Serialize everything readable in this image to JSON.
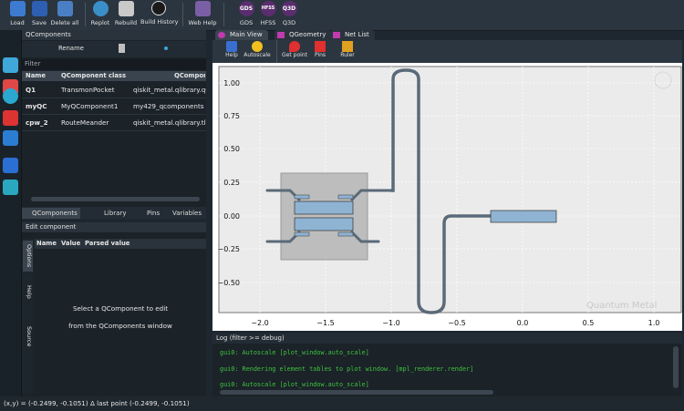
{
  "toolbar": {
    "buttons": [
      {
        "label": "Load",
        "icon": "folder-icon"
      },
      {
        "label": "Save",
        "icon": "floppy-disk-icon"
      },
      {
        "label": "Delete all",
        "icon": "trash-icon"
      },
      {
        "label": "Replot",
        "icon": "replot-icon"
      },
      {
        "label": "Rebuild",
        "icon": "tools-icon"
      },
      {
        "label": "Build History",
        "icon": "history-clock-icon"
      },
      {
        "label": "Web Help",
        "icon": "web-help-icon"
      },
      {
        "label": "GDS",
        "icon": "gds-icon",
        "badge": "GDS"
      },
      {
        "label": "HFSS",
        "icon": "hfss-icon",
        "badge": "HFSS"
      },
      {
        "label": "Q3D",
        "icon": "q3d-icon",
        "badge": "Q3D"
      }
    ]
  },
  "qcomponents_panel": {
    "title": "QComponents",
    "rename_label": "Rename",
    "filter_placeholder": "Filter",
    "columns": [
      "Name",
      "QComponent class",
      "QCompone"
    ],
    "rows": [
      {
        "name": "Q1",
        "class": "TransmonPocket",
        "module": "qiskit_metal.qlibrary.qu"
      },
      {
        "name": "myQC",
        "class": "MyQComponent1",
        "module": "my429_qcomponents"
      },
      {
        "name": "cpw_2",
        "class": "RouteMeander",
        "module": "qiskit_metal.qlibrary.tli"
      }
    ],
    "tabs": [
      "QComponents",
      "Library",
      "Pins",
      "Variables"
    ]
  },
  "edit_panel": {
    "title": "Edit component",
    "columns": [
      "Name",
      "Value",
      "Parsed value"
    ],
    "side_tabs": [
      "Options",
      "Help",
      "Source"
    ],
    "message_line1": "Select a QComponent to edit",
    "message_line2": "from the QComponents window"
  },
  "main_tabs": [
    "Main View",
    "QGeometry",
    "Net List"
  ],
  "plot_toolbar": [
    "Help",
    "Autoscale",
    "Get point",
    "Pins",
    "Ruler"
  ],
  "plot": {
    "watermark": "Quantum Metal",
    "x_ticks": [
      "−2.0",
      "−1.5",
      "−1.0",
      "−0.5",
      "0.0",
      "0.5",
      "1.0"
    ],
    "y_ticks": [
      "1.00",
      "0.75",
      "0.50",
      "0.25",
      "0.00",
      "−0.25",
      "−0.50"
    ]
  },
  "log": {
    "title": "Log  (filter >= debug)",
    "lines": [
      "gui0: Autoscale [plot_window.auto_scale]",
      "gui0: Rendering element tables to plot window. [mpl_renderer.render]",
      "gui0: Autoscale [plot_window.auto_scale]"
    ]
  },
  "status_bar": "(x,y) = (-0.2499, -0.1051)  Δ last point (-0.2499, -0.1051)",
  "colors": {
    "accent": "#3fa8d9",
    "qubit_fill": "#8fb3d3",
    "wire": "#5a6a78"
  }
}
